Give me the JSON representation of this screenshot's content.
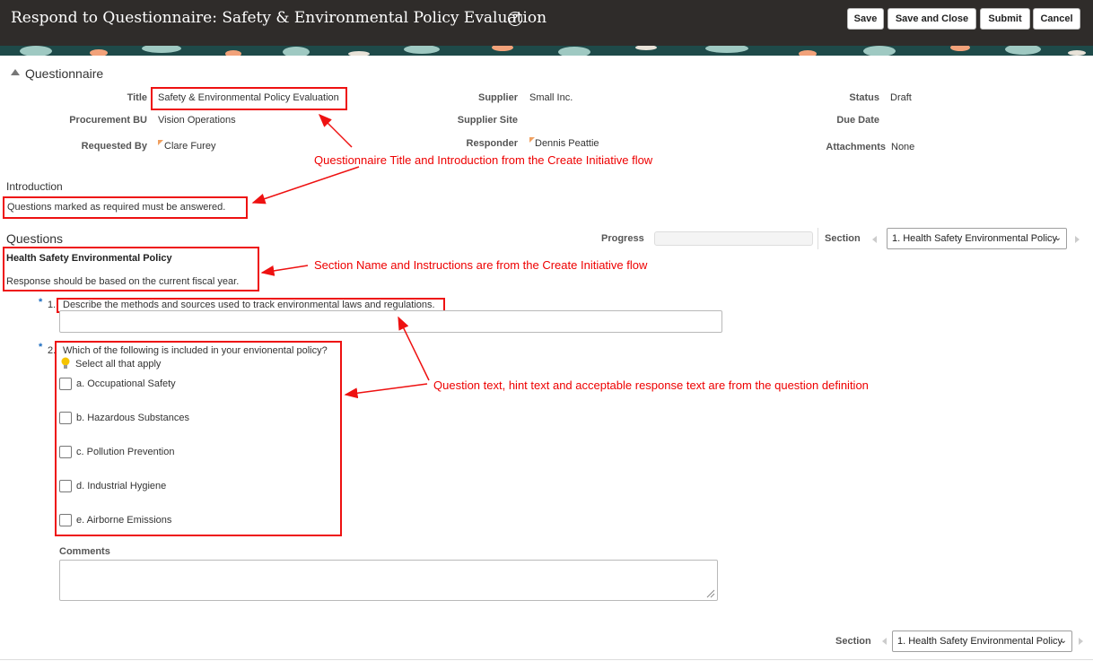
{
  "header": {
    "title": "Respond to Questionnaire: Safety & Environmental Policy Evaluation",
    "buttons": {
      "save": "Save",
      "save_close": "Save and Close",
      "submit": "Submit",
      "cancel": "Cancel"
    }
  },
  "questionnaire": {
    "heading": "Questionnaire",
    "fields": {
      "title_label": "Title",
      "title_value": "Safety & Environmental Policy Evaluation",
      "bu_label": "Procurement BU",
      "bu_value": "Vision Operations",
      "requested_label": "Requested By",
      "requested_value": "Clare Furey",
      "supplier_label": "Supplier",
      "supplier_value": "Small Inc.",
      "site_label": "Supplier Site",
      "responder_label": "Responder",
      "responder_value": "Dennis Peattie",
      "status_label": "Status",
      "status_value": "Draft",
      "due_label": "Due Date",
      "attach_label": "Attachments",
      "attach_value": "None"
    }
  },
  "intro": {
    "heading": "Introduction",
    "text": "Questions marked as required must be answered."
  },
  "questions": {
    "heading": "Questions",
    "progress_label": "Progress",
    "section_label": "Section",
    "section_value": "1. Health Safety Environmental Policy",
    "section_name": "Health Safety Environmental Policy",
    "section_instructions": "Response should be based on the current fiscal year.",
    "q1": {
      "number": "1.",
      "text": "Describe the methods and sources used to track environmental laws and regulations."
    },
    "q2": {
      "number": "2.",
      "text": "Which of the following is included in your envionental policy?",
      "hint": "Select all that apply",
      "options": [
        "a. Occupational Safety",
        "b. Hazardous Substances",
        "c. Pollution Prevention",
        "d. Industrial Hygiene",
        "e. Airborne Emissions"
      ]
    },
    "comments_label": "Comments"
  },
  "footer": {
    "section_label": "Section",
    "section_value": "1. Health Safety Environmental Policy"
  },
  "annotations": {
    "a1": "Questionnaire Title and Introduction from the Create Initiative flow",
    "a2": "Section Name and Instructions are from the Create Initiative flow",
    "a3": "Question text, hint text and acceptable response text are from the question definition"
  },
  "colors": {
    "header_bg": "#2f2c2a",
    "annotation": "#ee0000",
    "required": "#1a6bbf"
  }
}
